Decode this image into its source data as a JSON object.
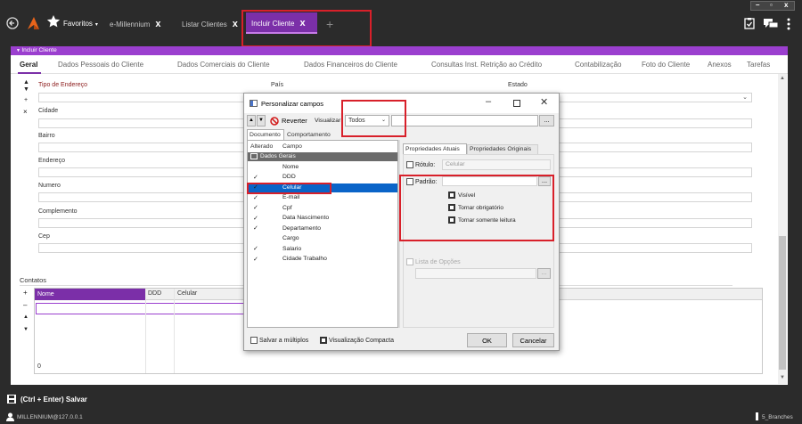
{
  "app": {
    "favorites_label": "Favoritos",
    "tabs": [
      {
        "label": "e-Millennium",
        "close": "x"
      },
      {
        "label": "Listar Clientes",
        "close": "x"
      },
      {
        "label": "Incluir Cliente",
        "close": "x"
      }
    ],
    "add_tab": "+",
    "window_controls": {
      "minimize": "–",
      "maximize": "▫",
      "close": "x"
    }
  },
  "form": {
    "panel_title": "Incluir Cliente",
    "tabs": [
      "Geral",
      "Dados Pessoais do Cliente",
      "Dados Comerciais do Cliente",
      "Dados Financeiros do Cliente",
      "Consultas Inst. Retrição ao Crédito",
      "Contabilização",
      "Foto do Cliente",
      "Anexos",
      "Tarefas"
    ],
    "fields": {
      "tipo_endereco": "Tipo de Endereço",
      "pais": "País",
      "estado": "Estado",
      "cidade": "Cidade",
      "bairro": "Bairro",
      "endereco": "Endereço",
      "numero": "Numero",
      "complemento": "Complemento",
      "cep": "Cep"
    },
    "contatos": {
      "title": "Contatos",
      "columns": [
        "Nome",
        "DDD",
        "Celular"
      ],
      "plus": "+",
      "minus": "–",
      "count": "0"
    }
  },
  "dialog": {
    "title": "Personalizar campos",
    "reverter_label": "Reverter",
    "visualizar_label": "Visualizar",
    "visualizar_value": "Todos",
    "ellipsis": "...",
    "tabs": [
      "Documento",
      "Comportamento"
    ],
    "list_headers": [
      "Alterado",
      "Campo"
    ],
    "group": "Dados Gerais",
    "items": [
      {
        "name": "Nome",
        "checked": false
      },
      {
        "name": "DDD",
        "checked": true
      },
      {
        "name": "Celular",
        "checked": true
      },
      {
        "name": "E-mail",
        "checked": true
      },
      {
        "name": "Cpf",
        "checked": true
      },
      {
        "name": "Data Nascimento",
        "checked": true
      },
      {
        "name": "Departamento",
        "checked": true
      },
      {
        "name": "Cargo",
        "checked": false
      },
      {
        "name": "Salario",
        "checked": true
      },
      {
        "name": "Cidade Trabalho",
        "checked": true
      }
    ],
    "check_mark": "✓",
    "prop_tabs": [
      "Propriedades Atuais",
      "Propriedades Originais"
    ],
    "rotulo_label": "Rótulo:",
    "rotulo_value": "Celular",
    "padrao_label": "Padrão:",
    "options": [
      "Visível",
      "Tornar obrigatório",
      "Tornar somente leitura"
    ],
    "lista_opcoes": "Lista de Opções",
    "salvar_multiplos": "Salvar a múltiplos",
    "visualizacao_compacta": "Visualização Compacta",
    "ok": "OK",
    "cancel": "Cancelar"
  },
  "footer": {
    "save_label": "(Ctrl + Enter) Salvar",
    "user": "MILLENNIUM@127.0.0.1",
    "branch": "5_Branches"
  }
}
